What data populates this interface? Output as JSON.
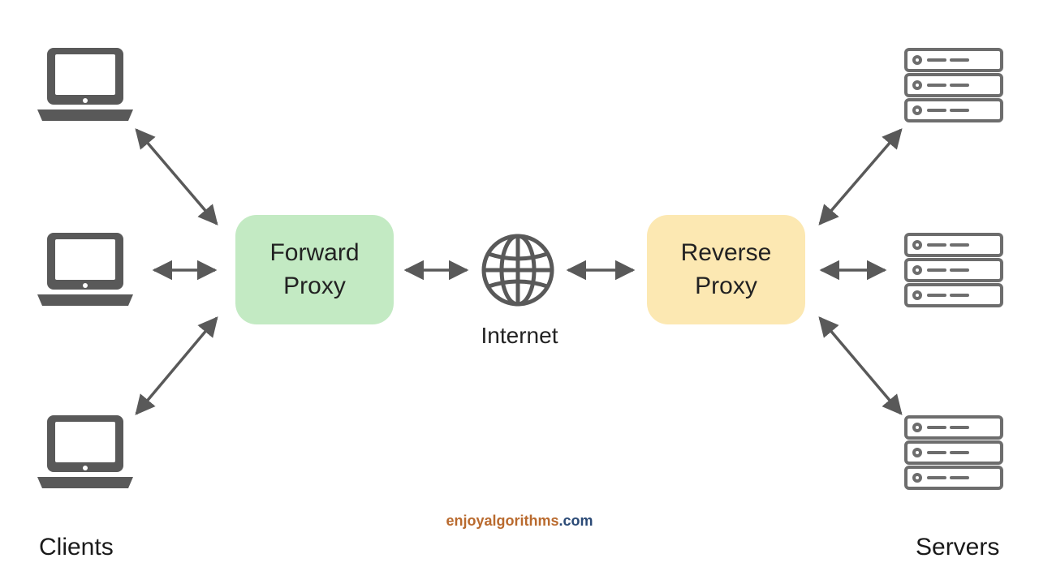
{
  "labels": {
    "forward_line1": "Forward",
    "forward_line2": "Proxy",
    "reverse_line1": "Reverse",
    "reverse_line2": "Proxy",
    "internet": "Internet",
    "clients": "Clients",
    "servers": "Servers",
    "credit_highlight": "enjoyalgorithms",
    "credit_suffix": ".com"
  },
  "colors": {
    "forward_bg": "#c3eac3",
    "reverse_bg": "#fce8b2",
    "icon_gray": "#595959",
    "arrow_gray": "#595959",
    "accent_text": "#b96a2e",
    "credit_text": "#2b4a76",
    "server_stroke": "#6d6d6d"
  },
  "diagram": {
    "type": "network-topology",
    "left_group": "Clients",
    "left_count": 3,
    "left_node_icon": "laptop",
    "right_group": "Servers",
    "right_count": 3,
    "right_node_icon": "server-rack",
    "center_chain": [
      "Forward Proxy",
      "Internet",
      "Reverse Proxy"
    ],
    "edges_bidirectional": true,
    "edges": [
      [
        "client-1",
        "forward-proxy"
      ],
      [
        "client-2",
        "forward-proxy"
      ],
      [
        "client-3",
        "forward-proxy"
      ],
      [
        "forward-proxy",
        "internet"
      ],
      [
        "internet",
        "reverse-proxy"
      ],
      [
        "reverse-proxy",
        "server-1"
      ],
      [
        "reverse-proxy",
        "server-2"
      ],
      [
        "reverse-proxy",
        "server-3"
      ]
    ]
  }
}
